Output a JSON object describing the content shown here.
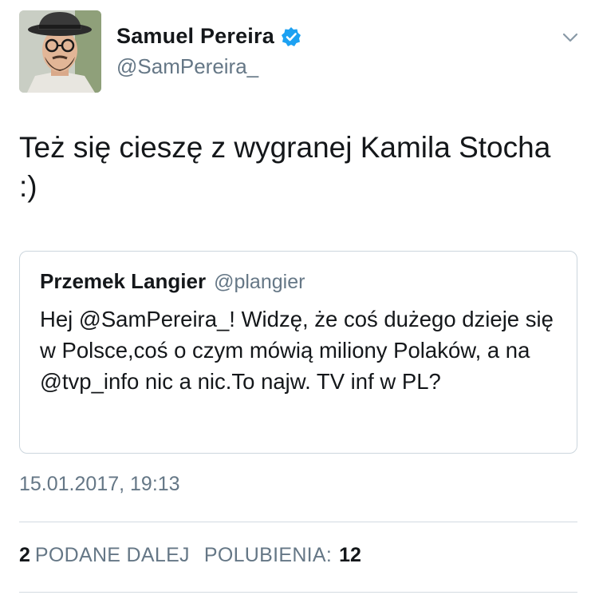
{
  "author": {
    "display_name": "Samuel Pereira",
    "handle": "@SamPereira_",
    "verified": true
  },
  "icons": {
    "verified": "verified-badge-icon",
    "menu": "chevron-down-icon"
  },
  "tweet": {
    "text": "Też się cieszę z wygranej Kamila Stocha\n:)"
  },
  "quoted_tweet": {
    "display_name": "Przemek Langier",
    "handle": "@plangier",
    "text": "Hej @SamPereira_! Widzę, że coś dużego dzieje się w Polsce,coś o czym mówią miliony Polaków, a na @tvp_info nic a nic.To najw. TV inf w PL?"
  },
  "timestamp": "15.01.2017, 19:13",
  "stats": {
    "retweets_count": "2",
    "retweets_label": "PODANE DALEJ",
    "likes_label": "POLUBIENIA:",
    "likes_count": "12"
  },
  "colors": {
    "text": "#14171a",
    "secondary": "#657786",
    "verified_blue": "#1da1f2",
    "border": "#ccd6dd"
  }
}
